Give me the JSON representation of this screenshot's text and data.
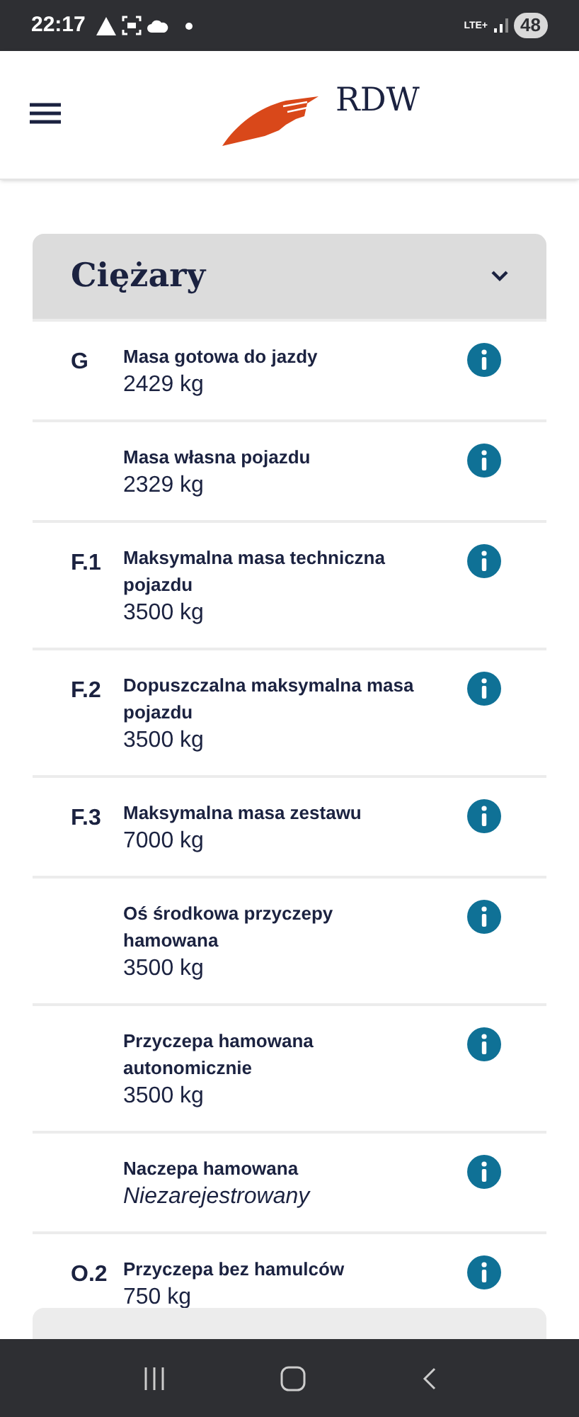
{
  "status_bar": {
    "time": "22:17",
    "network": "LTE+",
    "battery": "48"
  },
  "header": {
    "logo_text": "RDW"
  },
  "section": {
    "title": "Ciężary",
    "expanded": true,
    "rows": [
      {
        "code": "G",
        "label": "Masa gotowa do jazdy",
        "value": "2429 kg",
        "italic": false
      },
      {
        "label": "Masa własna pojazdu",
        "value": "2329 kg",
        "italic": false
      },
      {
        "code": "F.1",
        "label": "Maksymalna masa techniczna pojazdu",
        "value": "3500 kg",
        "italic": false
      },
      {
        "code": "F.2",
        "label": "Dopuszczalna maksymalna masa pojazdu",
        "value": "3500 kg",
        "italic": false
      },
      {
        "code": "F.3",
        "label": "Maksymalna masa zestawu",
        "value": "7000 kg",
        "italic": false
      },
      {
        "label": "Oś środkowa przyczepy hamowana",
        "value": "3500 kg",
        "italic": false
      },
      {
        "label": "Przyczepa hamowana autonomicznie",
        "value": "3500 kg",
        "italic": false
      },
      {
        "label": "Naczepa hamowana",
        "value": "Niezarejestrowany",
        "italic": true
      },
      {
        "code": "O.2",
        "label": "Przyczepa bez hamulców",
        "value": "750 kg",
        "italic": false
      }
    ]
  }
}
